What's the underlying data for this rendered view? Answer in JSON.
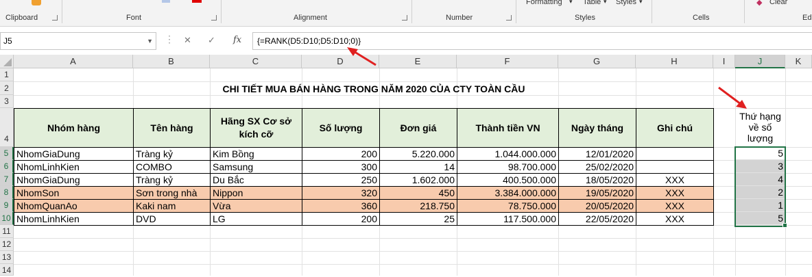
{
  "ribbon": {
    "top_labels": [
      "Formatting",
      "Table",
      "Styles",
      "Clear"
    ],
    "groups": [
      "Clipboard",
      "Font",
      "Alignment",
      "Number",
      "Styles",
      "Cells",
      "Ed"
    ]
  },
  "namebox": "J5",
  "formula_icons": {
    "cancel": "✕",
    "enter": "✓",
    "fx": "fx"
  },
  "formula": "{=RANK(D5:D10;D5:D10;0)}",
  "columns": [
    "A",
    "B",
    "C",
    "D",
    "E",
    "F",
    "G",
    "H",
    "I",
    "J",
    "K"
  ],
  "rows": [
    "1",
    "2",
    "3",
    "4",
    "5",
    "6",
    "7",
    "8",
    "9",
    "10",
    "11",
    "12",
    "13",
    "14"
  ],
  "title": "CHI TIẾT MUA BÁN HÀNG TRONG NĂM 2020 CỦA CTY TOÀN CẦU",
  "headers": [
    "Nhóm hàng",
    "Tên hàng",
    "Hãng SX Cơ sở kích cỡ",
    "Số lượng",
    "Đơn giá",
    "Thành tiền VN",
    "Ngày tháng",
    "Ghi chú"
  ],
  "rank_header": "Thứ hạng về số lượng",
  "table_rows": [
    {
      "a": "NhomGiaDung",
      "b": "Tràng kỷ",
      "c": "Kim Bồng",
      "d": "200",
      "e": "5.220.000",
      "f": "1.044.000.000",
      "g": "12/01/2020",
      "h": "",
      "j": "5"
    },
    {
      "a": "NhomLinhKien",
      "b": "COMBO",
      "c": "Samsung",
      "d": "300",
      "e": "14",
      "f": "98.700.000",
      "g": "25/02/2020",
      "h": "",
      "j": "3"
    },
    {
      "a": "NhomGiaDung",
      "b": "Tràng kỷ",
      "c": "Du Bắc",
      "d": "250",
      "e": "1.602.000",
      "f": "400.500.000",
      "g": "18/05/2020",
      "h": "XXX",
      "j": "4"
    },
    {
      "a": "NhomSon",
      "b": "Sơn trong nhà",
      "c": "Nippon",
      "d": "320",
      "e": "450",
      "f": "3.384.000.000",
      "g": "19/05/2020",
      "h": "XXX",
      "j": "2"
    },
    {
      "a": "NhomQuanAo",
      "b": "Kaki nam",
      "c": "Vừa",
      "d": "360",
      "e": "218.750",
      "f": "78.750.000",
      "g": "20/05/2020",
      "h": "XXX",
      "j": "1"
    },
    {
      "a": "NhomLinhKien",
      "b": "DVD",
      "c": "LG",
      "d": "200",
      "e": "25",
      "f": "117.500.000",
      "g": "22/05/2020",
      "h": "XXX",
      "j": "5"
    }
  ],
  "colors": {
    "header_fill": "#e2efda",
    "highlight_fill": "#f8cbad",
    "selection": "#217346",
    "arrow": "#e02020"
  }
}
